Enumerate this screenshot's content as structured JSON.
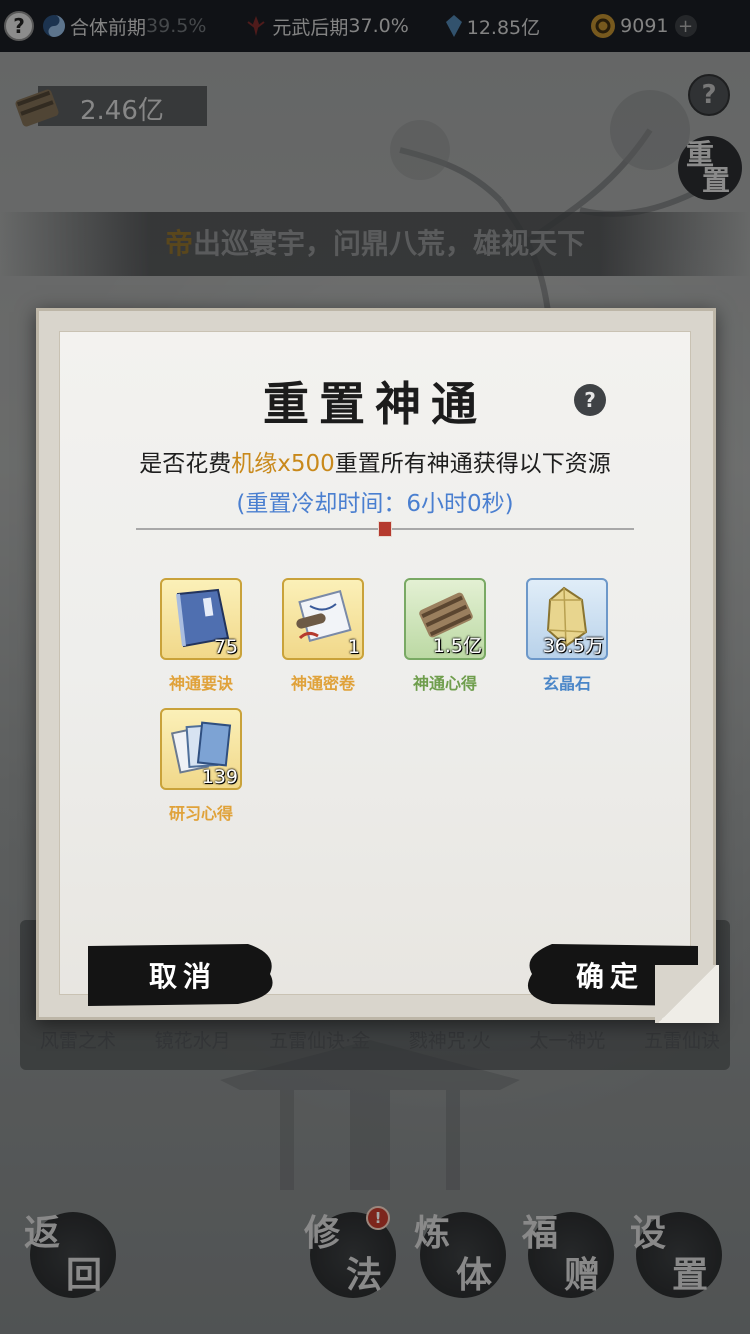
{
  "topbar": {
    "realm1_label": "合体前期",
    "realm1_pct": "39.5%",
    "realm2_label": "元武后期",
    "realm2_pct": "37.0%",
    "crystals": "12.85亿",
    "coins": "9091",
    "plus": "+"
  },
  "resource_chip": {
    "value": "2.46亿"
  },
  "help_label": "?",
  "reset_button": {
    "char1": "重",
    "char2": "置"
  },
  "banner": {
    "highlight": "帝",
    "rest": "出巡寰宇，问鼎八荒，雄视天下"
  },
  "skills": [
    "风雷之术",
    "镜花水月",
    "五雷仙诀·金",
    "戮神咒·火",
    "太一神光",
    "五雷仙诀"
  ],
  "modal": {
    "title": "重置神通",
    "help": "?",
    "desc_prefix": "是否花费",
    "desc_cost": "机缘x500",
    "desc_suffix": "重置所有神通获得以下资源",
    "cooldown": "(重置冷却时间：6小时0秒)",
    "items": [
      {
        "name": "神通要诀",
        "count": "75",
        "icon": "blue-book-icon",
        "tier": "gold"
      },
      {
        "name": "神通密卷",
        "count": "1",
        "icon": "scroll-icon",
        "tier": "gold"
      },
      {
        "name": "神通心得",
        "count": "1.5亿",
        "icon": "bamboo-scroll-icon",
        "tier": "green"
      },
      {
        "name": "玄晶石",
        "count": "36.5万",
        "icon": "crystal-icon",
        "tier": "blue"
      },
      {
        "name": "研习心得",
        "count": "139",
        "icon": "card-stack-icon",
        "tier": "gold"
      }
    ],
    "cancel_label": "取消",
    "confirm_label": "确定"
  },
  "nav": {
    "back": {
      "c1": "返",
      "c2": "回"
    },
    "cultivate": {
      "c1": "修",
      "c2": "法",
      "badge": "!"
    },
    "body": {
      "c1": "炼",
      "c2": "体"
    },
    "gift": {
      "c1": "福",
      "c2": "赠"
    },
    "settings": {
      "c1": "设",
      "c2": "置"
    }
  },
  "colors": {
    "gold_text": "#c9891b",
    "blue_text": "#4a7fd0",
    "modal_bg": "#eeeeec",
    "badge_red": "#c0392b"
  }
}
